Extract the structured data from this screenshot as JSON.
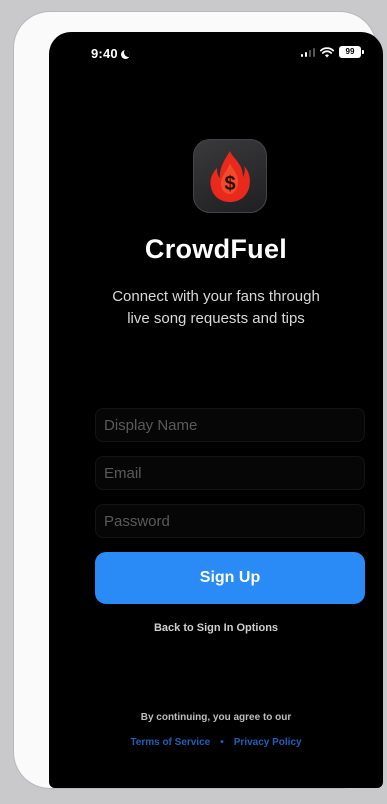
{
  "status_bar": {
    "time": "9:40",
    "battery": "99"
  },
  "app": {
    "name": "CrowdFuel",
    "tagline_line1": "Connect with your fans through",
    "tagline_line2": "live song requests and tips",
    "icon": "flame-dollar-icon",
    "brand_color": "#e8291c",
    "accent_color": "#2a8af6"
  },
  "form": {
    "display_name_placeholder": "Display Name",
    "email_placeholder": "Email",
    "password_placeholder": "Password",
    "display_name_value": "",
    "email_value": "",
    "password_value": "",
    "submit_label": "Sign Up"
  },
  "back_link": "Back to Sign In Options",
  "legal": {
    "notice": "By continuing, you agree to our",
    "terms": "Terms of Service",
    "separator": "•",
    "privacy": "Privacy Policy"
  }
}
